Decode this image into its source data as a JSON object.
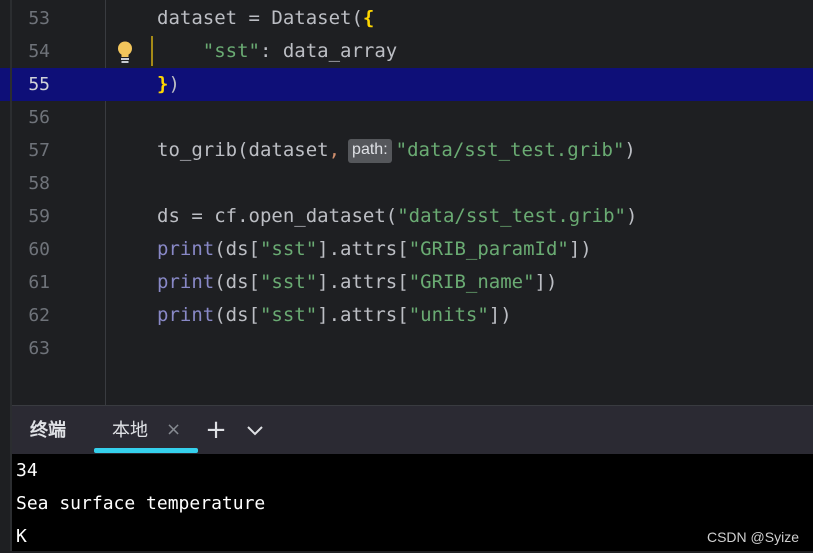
{
  "editor": {
    "lines": [
      {
        "num": "53"
      },
      {
        "num": "54"
      },
      {
        "num": "55"
      },
      {
        "num": "56"
      },
      {
        "num": "57"
      },
      {
        "num": "58"
      },
      {
        "num": "59"
      },
      {
        "num": "60"
      },
      {
        "num": "61"
      },
      {
        "num": "62"
      },
      {
        "num": "63"
      }
    ],
    "current_line": "55",
    "code": {
      "l53_a": "dataset = Dataset(",
      "l53_b": "{",
      "l54_indent": "    ",
      "l54_key": "\"sst\"",
      "l54_rest": ": data_array",
      "l55_brace": "}",
      "l55_paren": ")",
      "l57_a": "to_grib(dataset",
      "l57_comma": ",",
      "l57_hint": "path:",
      "l57_str": "\"data/sst_test.grib\"",
      "l57_end": ")",
      "l59_a": "ds = cf.open_dataset(",
      "l59_str": "\"data/sst_test.grib\"",
      "l59_end": ")",
      "l60_print": "print",
      "l60_a": "(ds[",
      "l60_k": "\"sst\"",
      "l60_b": "].attrs[",
      "l60_s": "\"GRIB_paramId\"",
      "l60_end": "])",
      "l61_print": "print",
      "l61_a": "(ds[",
      "l61_k": "\"sst\"",
      "l61_b": "].attrs[",
      "l61_s": "\"GRIB_name\"",
      "l61_end": "])",
      "l62_print": "print",
      "l62_a": "(ds[",
      "l62_k": "\"sst\"",
      "l62_b": "].attrs[",
      "l62_s": "\"units\"",
      "l62_end": "])"
    },
    "icons": {
      "bulb": "lightbulb-icon"
    }
  },
  "terminal": {
    "title": "终端",
    "tab_label": "本地",
    "tab_close": "×",
    "add_tab": "+",
    "output": [
      "34",
      "Sea surface temperature",
      "K"
    ]
  },
  "watermark": "CSDN @Syize",
  "colors": {
    "background": "#1e1f22",
    "current_line": "#0e0f78",
    "string": "#6aab73",
    "builtin": "#8888c6",
    "tab_accent": "#35d0ec",
    "terminal_bg": "#000000"
  }
}
